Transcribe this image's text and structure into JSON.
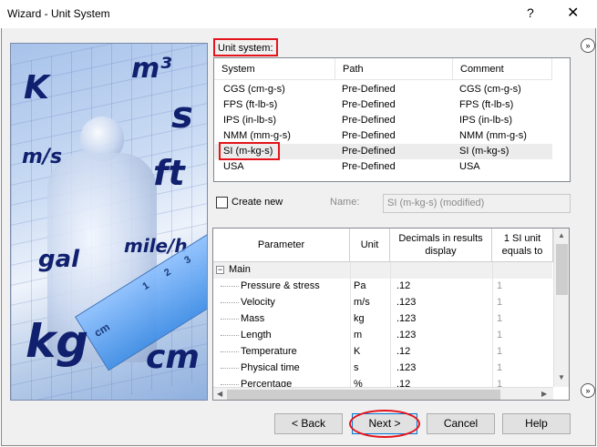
{
  "window": {
    "title": "Wizard - Unit System",
    "help_glyph": "?",
    "close_glyph": "✕"
  },
  "picture": {
    "units": [
      "K",
      "m³",
      "s",
      "m/s",
      "ft",
      "gal",
      "mile/h",
      "kg",
      "cm"
    ],
    "ruler": {
      "numbers": [
        "1",
        "2",
        "3"
      ],
      "label": "cm"
    }
  },
  "unit_system": {
    "label": "Unit system:",
    "columns": [
      "System",
      "Path",
      "Comment"
    ],
    "rows": [
      {
        "system": "CGS (cm-g-s)",
        "path": "Pre-Defined",
        "comment": "CGS (cm-g-s)"
      },
      {
        "system": "FPS (ft-lb-s)",
        "path": "Pre-Defined",
        "comment": "FPS (ft-lb-s)"
      },
      {
        "system": "IPS (in-lb-s)",
        "path": "Pre-Defined",
        "comment": "IPS (in-lb-s)"
      },
      {
        "system": "NMM (mm-g-s)",
        "path": "Pre-Defined",
        "comment": "NMM (mm-g-s)"
      },
      {
        "system": "SI (m-kg-s)",
        "path": "Pre-Defined",
        "comment": "SI (m-kg-s)"
      },
      {
        "system": "USA",
        "path": "Pre-Defined",
        "comment": "USA"
      }
    ],
    "selected": "SI (m-kg-s)"
  },
  "create_new": {
    "label": "Create new",
    "checked": false,
    "name_label": "Name:",
    "name_value": "SI (m-kg-s) (modified)"
  },
  "parameters": {
    "columns": [
      "Parameter",
      "Unit",
      "Decimals in results display",
      "1 SI unit equals to"
    ],
    "group": "Main",
    "rows": [
      {
        "parameter": "Pressure & stress",
        "unit": "Pa",
        "decimals": ".12",
        "equals": "1"
      },
      {
        "parameter": "Velocity",
        "unit": "m/s",
        "decimals": ".123",
        "equals": "1"
      },
      {
        "parameter": "Mass",
        "unit": "kg",
        "decimals": ".123",
        "equals": "1"
      },
      {
        "parameter": "Length",
        "unit": "m",
        "decimals": ".123",
        "equals": "1"
      },
      {
        "parameter": "Temperature",
        "unit": "K",
        "decimals": ".12",
        "equals": "1"
      },
      {
        "parameter": "Physical time",
        "unit": "s",
        "decimals": ".123",
        "equals": "1"
      },
      {
        "parameter": "Percentage",
        "unit": "%",
        "decimals": ".12",
        "equals": "1"
      }
    ]
  },
  "buttons": {
    "back": "< Back",
    "next": "Next >",
    "cancel": "Cancel",
    "help": "Help"
  },
  "side_toggle_glyph": "»",
  "colors": {
    "highlight_red": "#e3141b",
    "picture_text": "#10206e",
    "ruler_blue": "#3f8fe8"
  }
}
